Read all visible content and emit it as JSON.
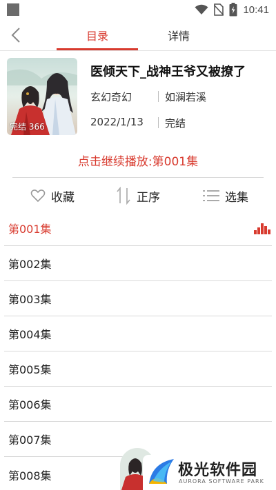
{
  "status_bar": {
    "time": "10:41",
    "icons": [
      "square-notification-icon",
      "wifi-icon",
      "no-sim-icon",
      "battery-charging-icon"
    ]
  },
  "header": {
    "back_icon": "chevron-left-icon",
    "tabs": [
      {
        "label": "目录",
        "active": true
      },
      {
        "label": "详情",
        "active": false
      }
    ],
    "accent_color": "#d83a2e"
  },
  "book": {
    "title": "医倾天下_战神王爷又被撩了",
    "cover_badge": "完结 366",
    "genre": "玄幻奇幻",
    "author": "如澜若溪",
    "date": "2022/1/13",
    "status": "完结"
  },
  "continue_label": "点击继续播放:第001集",
  "actions": {
    "favorite": {
      "label": "收藏",
      "icon": "heart-outline-icon"
    },
    "sort": {
      "label": "正序",
      "icon": "sort-arrows-icon"
    },
    "select": {
      "label": "选集",
      "icon": "list-icon"
    }
  },
  "episodes": [
    {
      "label": "第001集",
      "playing": true
    },
    {
      "label": "第002集",
      "playing": false
    },
    {
      "label": "第003集",
      "playing": false
    },
    {
      "label": "第004集",
      "playing": false
    },
    {
      "label": "第005集",
      "playing": false
    },
    {
      "label": "第006集",
      "playing": false
    },
    {
      "label": "第007集",
      "playing": false
    },
    {
      "label": "第008集",
      "playing": false
    }
  ],
  "watermark": {
    "name": "极光软件园",
    "subtitle": "AURORA SOFTWARE PARK"
  }
}
